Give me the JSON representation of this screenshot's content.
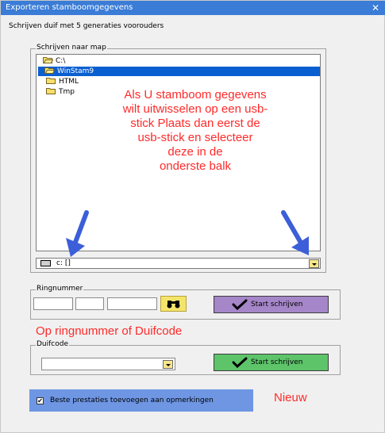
{
  "window": {
    "title": "Exporteren stamboomgegevens",
    "close_glyph": "✕"
  },
  "subtitle": "Schrijven duif met 5 generaties voorouders",
  "folder_group": {
    "label": "Schrijven naar map",
    "tree": [
      {
        "label": "C:\\",
        "icon": "open-folder-icon",
        "selected": false
      },
      {
        "label": "WinStam9",
        "icon": "open-folder-icon",
        "selected": true
      },
      {
        "label": "HTML",
        "icon": "folder-icon",
        "selected": false
      },
      {
        "label": "Tmp",
        "icon": "folder-icon",
        "selected": false
      }
    ],
    "annotation": [
      "Als U stamboom gegevens",
      "wilt uitwisselen  op een usb-",
      "stick Plaats dan eerst de",
      "usb-stick en selecteer",
      "deze in de",
      "onderste balk"
    ],
    "drive": {
      "value": "c: []",
      "icon": "drive-icon"
    }
  },
  "ring_group": {
    "label": "Ringnummer",
    "search_icon": "binoculars-icon",
    "start_label": "Start schrijven"
  },
  "annotation2": "Op ringnummer  of Duifcode",
  "duif_group": {
    "label": "Duifcode",
    "start_label": "Start schrijven"
  },
  "option": {
    "label": "Beste prestaties toevoegen aan opmerkingen",
    "checked": true,
    "check_glyph": "✔"
  },
  "nieuw": "Nieuw",
  "colors": {
    "title_bar": "#3a7cd6",
    "annotation": "#ff2a2a",
    "selection": "#0a5fd0",
    "purple_button": "#a586c8",
    "green_button": "#5dc46a",
    "option_bar": "#6e96e3",
    "arrow": "#3c5ed8"
  }
}
